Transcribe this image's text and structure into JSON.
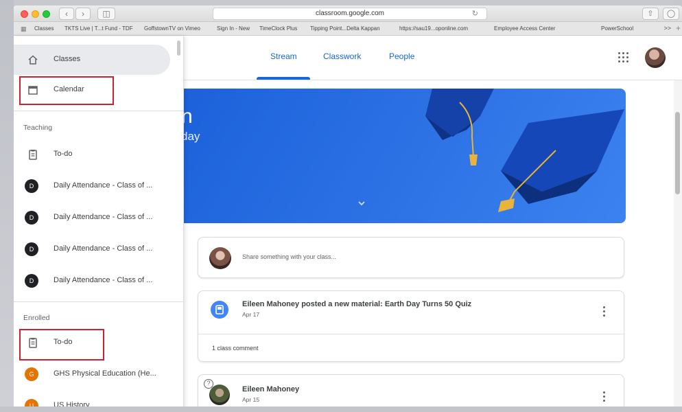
{
  "browser": {
    "url": "classroom.google.com",
    "bookmarks": [
      "Classes",
      "TKTS Live | T...t Fund - TDF",
      "GoffstownTV on Vimeo",
      "Sign In - New",
      "TimeClock Plus",
      "Tipping Point...Delta Kappan",
      "https://sau19...oponline.com",
      "Employee Access Center",
      "PowerSchool"
    ],
    "more": ">>"
  },
  "tabs": [
    "Stream",
    "Classwork",
    "People"
  ],
  "banner": {
    "title_fragment": "n",
    "subtitle_fragment": "day"
  },
  "drawer": {
    "classes": "Classes",
    "calendar": "Calendar",
    "teaching_label": "Teaching",
    "teaching_todo": "To-do",
    "teaching_classes": [
      {
        "initial": "D",
        "name": "Daily Attendance - Class of ..."
      },
      {
        "initial": "D",
        "name": "Daily Attendance - Class of ..."
      },
      {
        "initial": "D",
        "name": "Daily Attendance - Class of ..."
      },
      {
        "initial": "D",
        "name": "Daily Attendance - Class of ..."
      }
    ],
    "enrolled_label": "Enrolled",
    "enrolled_todo": "To-do",
    "enrolled_classes": [
      {
        "initial": "G",
        "name": "GHS Physical Education (He..."
      },
      {
        "initial": "U",
        "name": "US History"
      }
    ]
  },
  "stream": {
    "share_placeholder": "Share something with your class...",
    "post1": {
      "title": "Eileen Mahoney posted a new material: Earth Day Turns 50 Quiz",
      "date": "Apr 17",
      "comments": "1 class comment"
    },
    "post2": {
      "name": "Eileen Mahoney",
      "date": "Apr 15"
    }
  },
  "colors": {
    "accent": "#1967d2",
    "banner": "#2a6fe6",
    "highlight": "#d0202f"
  }
}
